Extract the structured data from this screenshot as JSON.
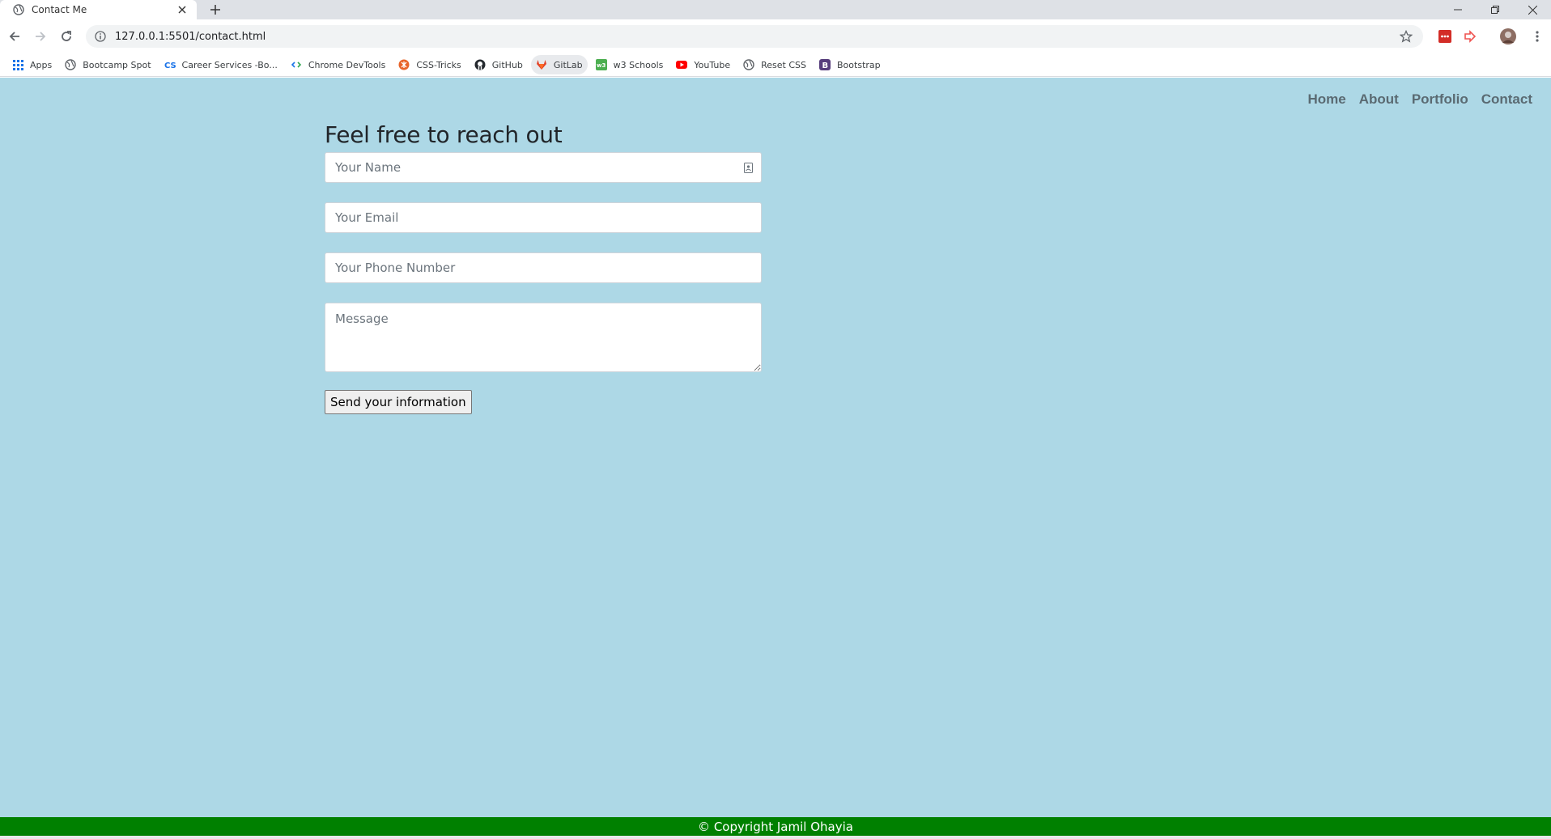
{
  "browser": {
    "tab_title": "Contact Me",
    "url": "127.0.0.1:5501/contact.html",
    "bookmarks": [
      {
        "label": "Apps",
        "icon": "apps-grid-icon",
        "color": "#1a73e8"
      },
      {
        "label": "Bootcamp Spot",
        "icon": "globe-icon",
        "color": "#5f6368"
      },
      {
        "label": "Career Services -Bo...",
        "icon": "cs-logo-icon",
        "color": "#1a73e8"
      },
      {
        "label": "Chrome DevTools",
        "icon": "devtools-icon",
        "color": "#1a73e8"
      },
      {
        "label": "CSS-Tricks",
        "icon": "css-tricks-icon",
        "color": "#e8642a"
      },
      {
        "label": "GitHub",
        "icon": "github-icon",
        "color": "#24292e"
      },
      {
        "label": "GitLab",
        "icon": "gitlab-icon",
        "color": "#e24329"
      },
      {
        "label": "w3 Schools",
        "icon": "w3schools-icon",
        "color": "#4caf50"
      },
      {
        "label": "YouTube",
        "icon": "youtube-icon",
        "color": "#ff0000"
      },
      {
        "label": "Reset CSS",
        "icon": "globe-icon",
        "color": "#5f6368"
      },
      {
        "label": "Bootstrap",
        "icon": "bootstrap-icon",
        "color": "#563d7c"
      }
    ]
  },
  "nav": {
    "home": "Home",
    "about": "About",
    "portfolio": "Portfolio",
    "contact": "Contact"
  },
  "contact": {
    "heading": "Feel free to reach out",
    "name_placeholder": "Your Name",
    "email_placeholder": "Your Email",
    "phone_placeholder": "Your Phone Number",
    "message_placeholder": "Message",
    "submit_label": "Send your information"
  },
  "footer": {
    "text": "© Copyright Jamil Ohayia"
  },
  "colors": {
    "page_background": "#add8e6",
    "footer_background": "#008000",
    "nav_link": "#5a6a72"
  }
}
